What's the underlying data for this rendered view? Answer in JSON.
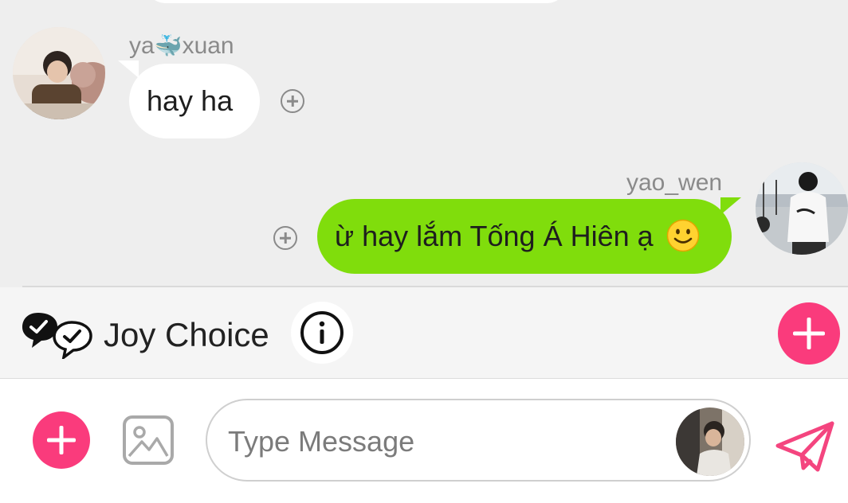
{
  "messages": [
    {
      "direction": "incoming",
      "sender_prefix": "ya",
      "sender_emoji": "🐳",
      "sender_suffix": "xuan",
      "text": "hay ha",
      "avatar": "avatar-photo-yaxuan"
    },
    {
      "direction": "outgoing",
      "sender": "yao_wen",
      "text": "ừ hay lắm Tống Á Hiên ạ",
      "trailing_emoji": "slightly-smiling-face-icon",
      "avatar": "avatar-photo-yaowen"
    }
  ],
  "joy_bar": {
    "label": "Joy Choice",
    "icon": "chat-bubbles-check-icon",
    "info_icon": "info-icon",
    "add_icon": "plus-icon"
  },
  "composer": {
    "placeholder": "Type Message",
    "value": "",
    "add_icon": "plus-icon",
    "image_icon": "image-icon",
    "sticker_icon": "sticker-avatar",
    "send_icon": "paper-plane-icon"
  },
  "colors": {
    "background": "#eeeeee",
    "incoming_bubble": "#ffffff",
    "outgoing_bubble": "#80dd0c",
    "accent": "#fa3b7c",
    "name_text": "#8a8a8a"
  }
}
